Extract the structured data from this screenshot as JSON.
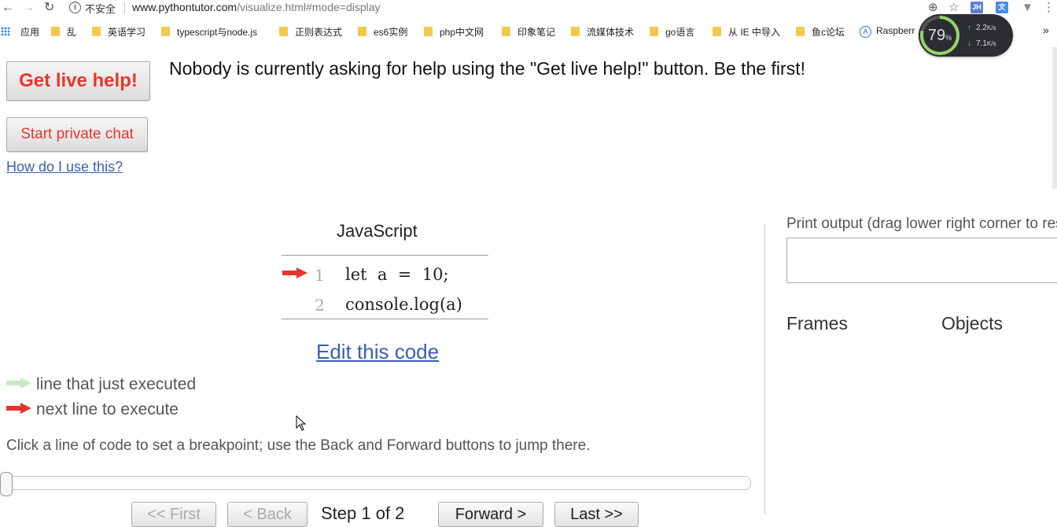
{
  "browser": {
    "security_text": "不安全",
    "url_host": "www.pythontutor.com",
    "url_path": "/visualize.html#mode=display",
    "extensions": [
      "JH"
    ]
  },
  "bookmarks": [
    {
      "label": "应用",
      "icon": "apps-grid-icon"
    },
    {
      "label": "乱",
      "icon": "folder-icon"
    },
    {
      "label": "英语学习",
      "icon": "folder-icon"
    },
    {
      "label": "typescript与node.js",
      "icon": "folder-icon"
    },
    {
      "label": "正则表达式",
      "icon": "folder-icon"
    },
    {
      "label": "es6实例",
      "icon": "folder-icon"
    },
    {
      "label": "php中文网",
      "icon": "folder-icon"
    },
    {
      "label": "印象笔记",
      "icon": "folder-icon"
    },
    {
      "label": "流媒体技术",
      "icon": "folder-icon"
    },
    {
      "label": "go语言",
      "icon": "folder-icon"
    },
    {
      "label": "从 IE 中导入",
      "icon": "folder-icon"
    },
    {
      "label": "鱼c论坛",
      "icon": "folder-icon"
    },
    {
      "label": "Raspberr",
      "icon": "ie-icon"
    },
    {
      "label": "»",
      "icon": ""
    }
  ],
  "netspeed": {
    "percent": "79",
    "percent_unit": "%",
    "upload": "2.2",
    "download": "7.1",
    "unit": "K/s"
  },
  "help": {
    "live_button": "Get live help!",
    "message": "Nobody is currently asking for help using the \"Get live help!\" button. Be the first!",
    "private_chat_button": "Start private chat",
    "howto_link": "How do I use this?"
  },
  "code": {
    "language": "JavaScript",
    "lines": [
      {
        "number": "1",
        "text": "let  a  =  10;"
      },
      {
        "number": "2",
        "text": "console.log(a)"
      }
    ],
    "edit_link": "Edit this code"
  },
  "legend": {
    "executed": "line that just executed",
    "next": "next line to execute",
    "executed_color": "#c9e8c4",
    "next_color": "#e4352c"
  },
  "hint": "Click a line of code to set a breakpoint; use the Back and Forward buttons to jump there.",
  "navigation": {
    "first": "<< First",
    "back": "< Back",
    "step": "Step 1 of 2",
    "forward": "Forward >",
    "last": "Last >>"
  },
  "output": {
    "print_label": "Print output (drag lower right corner to resize)",
    "frames_label": "Frames",
    "objects_label": "Objects"
  }
}
